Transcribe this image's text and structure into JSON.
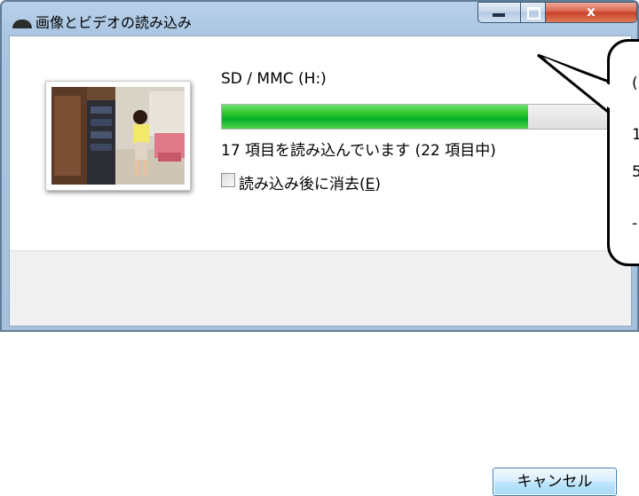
{
  "window": {
    "title": "画像とビデオの読み込み",
    "buttons": {
      "close_glyph": "x"
    }
  },
  "import": {
    "device_label": "SD / MMC (H:)",
    "progress_fraction": 0.733,
    "status_text": "17 項目を読み込んでいます (22 項目中)",
    "erase_checkbox": {
      "label": "読み込み後に消去(",
      "accel": "E",
      "label_end": ")",
      "checked": false
    },
    "cancel_label": "キャンセル"
  },
  "callout": {
    "partial_chars": [
      "(",
      "1",
      "5",
      "-"
    ]
  },
  "colors": {
    "progress_green": "#06b025",
    "frame_blue": "#a9c5e2",
    "close_red": "#c8402a"
  }
}
